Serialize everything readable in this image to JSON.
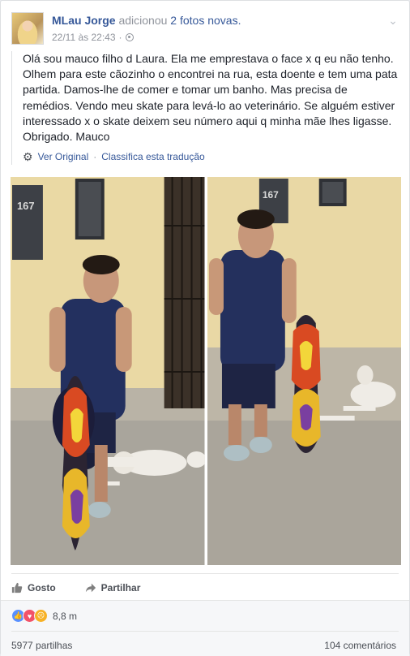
{
  "post": {
    "author": "MLau Jorge",
    "action_prefix": "adicionou",
    "action_link": "2 fotos novas.",
    "timestamp": "22/11 às 22:43",
    "separator": "·",
    "menu_icon": "chevron-down-icon",
    "audience_icon": "globe-icon",
    "body": "Olá sou mauco filho d Laura. Ela me emprestava o face x q eu não tenho. Olhem para este cãozinho o encontrei na rua, esta doente e tem uma pata partida. Damos-lhe de comer e tomar um banho. Mas precisa de remédios. Vendo meu skate para levá-lo ao veterinário. Se alguém estiver interessado x o skate deixem seu número aqui q minha mãe lhes ligasse. Obrigado. Mauco",
    "translation": {
      "icon": "gear-icon",
      "see_original": "Ver Original",
      "separator": "·",
      "rate": "Classifica esta tradução"
    },
    "photos": [
      {
        "name": "photo-1",
        "house_number": "167"
      },
      {
        "name": "photo-2",
        "house_number": "167"
      }
    ]
  },
  "actions": {
    "like_label": "Gosto",
    "like_icon": "thumbs-up-icon",
    "share_label": "Partilhar",
    "share_icon": "share-arrow-icon"
  },
  "stats": {
    "reaction_icons": [
      "like-icon",
      "love-icon",
      "sad-icon"
    ],
    "reactions_count": "8,8 m",
    "shares": "5977 partilhas",
    "comments": "104 comentários"
  },
  "colors": {
    "link": "#365899",
    "muted": "#90949c",
    "like_blue": "#5890ff",
    "love_red": "#f25268",
    "sad_yellow": "#f7b125"
  }
}
